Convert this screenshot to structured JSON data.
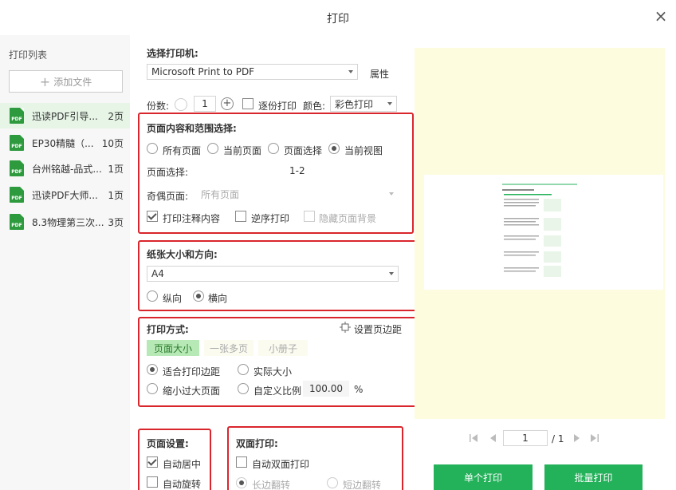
{
  "window": {
    "title": "打印",
    "close_icon": "×"
  },
  "print_list": {
    "title": "打印列表",
    "add_file_label": "添加文件",
    "files": [
      {
        "name": "迅读PDF引导...",
        "pages": "2页"
      },
      {
        "name": "EP30精髓（...",
        "pages": "10页"
      },
      {
        "name": "台州铭越-品式...",
        "pages": "1页"
      },
      {
        "name": "迅读PDF大师...",
        "pages": "1页"
      },
      {
        "name": "8.3物理第三次...",
        "pages": "3页"
      }
    ],
    "icon_text": "PDF"
  },
  "printer": {
    "label": "选择打印机:",
    "selected": "Microsoft Print to PDF",
    "properties_label": "属性",
    "copies_label": "份数:",
    "copies_value": "1",
    "collate_label": "逐份打印",
    "color_label": "颜色:",
    "color_value": "彩色打印"
  },
  "page_range": {
    "title": "页面内容和范围选择:",
    "options": [
      "所有页面",
      "当前页面",
      "页面选择",
      "当前视图"
    ],
    "page_select_label": "页面选择:",
    "page_select_value": "1-2",
    "odd_even_label": "奇偶页面:",
    "odd_even_value": "所有页面",
    "print_annotations_label": "打印注释内容",
    "reverse_label": "逆序打印",
    "hide_background_label": "隐藏页面背景"
  },
  "paper": {
    "title": "纸张大小和方向:",
    "size": "A4",
    "portrait_label": "纵向",
    "landscape_label": "横向"
  },
  "print_mode": {
    "title": "打印方式:",
    "set_margins_label": "设置页边距",
    "tabs": [
      "页面大小",
      "一张多页",
      "小册子"
    ],
    "fit_margins_label": "适合打印边距",
    "actual_size_label": "实际大小",
    "shrink_label": "缩小过大页面",
    "custom_scale_label": "自定义比例",
    "scale_value": "100.00",
    "percent": "%"
  },
  "page_settings": {
    "title": "页面设置:",
    "auto_center_label": "自动居中",
    "auto_rotate_label": "自动旋转"
  },
  "duplex": {
    "title": "双面打印:",
    "auto_duplex_label": "自动双面打印",
    "long_edge_label": "长边翻转",
    "short_edge_label": "短边翻转"
  },
  "preview": {
    "current_page": "1",
    "total_pages": "/ 1"
  },
  "actions": {
    "single_print_label": "单个打印",
    "batch_print_label": "批量打印"
  },
  "colors": {
    "accent_green": "#23b15a",
    "highlight_red": "#d9262c",
    "preview_bg": "#fdfcdf"
  }
}
